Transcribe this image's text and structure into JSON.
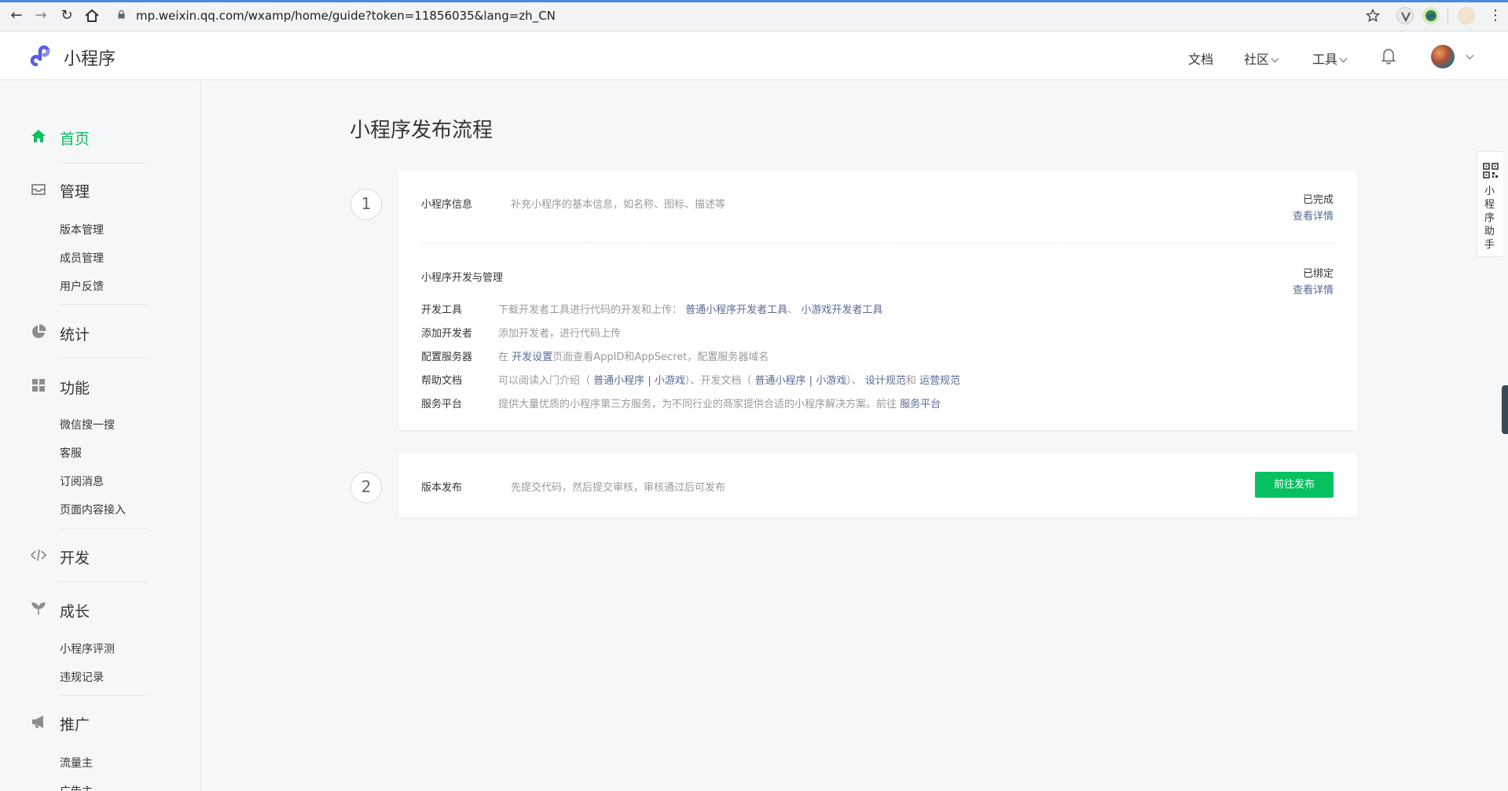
{
  "browser": {
    "url": "mp.weixin.qq.com/wxamp/home/guide?token=11856035&lang=zh_CN"
  },
  "header": {
    "brand": "小程序",
    "nav": {
      "docs": "文档",
      "community": "社区",
      "tools": "工具"
    }
  },
  "sidebar": {
    "home": "首页",
    "manage": "管理",
    "manage_items": [
      "版本管理",
      "成员管理",
      "用户反馈"
    ],
    "stats": "统计",
    "features": "功能",
    "feature_items": [
      "微信搜一搜",
      "客服",
      "订阅消息",
      "页面内容接入"
    ],
    "develop": "开发",
    "growth": "成长",
    "growth_items": [
      "小程序评测",
      "违规记录"
    ],
    "promote": "推广",
    "promote_items": [
      "流量主",
      "广告主"
    ]
  },
  "main": {
    "title": "小程序发布流程",
    "step1": {
      "number": "1",
      "info_label": "小程序信息",
      "info_desc": "补充小程序的基本信息，如名称、图标、描述等",
      "info_status": "已完成",
      "info_link": "查看详情",
      "dev_label": "小程序开发与管理",
      "dev_status": "已绑定",
      "dev_link": "查看详情",
      "rows": {
        "tools_label": "开发工具",
        "tools_text": "下载开发者工具进行代码的开发和上传：",
        "tools_link1": "普通小程序开发者工具",
        "tools_sep": "、",
        "tools_link2": "小游戏开发者工具",
        "adddev_label": "添加开发者",
        "adddev_text": "添加开发者，进行代码上传",
        "server_label": "配置服务器",
        "server_pre": "在",
        "server_link": "开发设置",
        "server_post": "页面查看AppID和AppSecret，配置服务器域名",
        "help_label": "帮助文档",
        "help_t1": "可以阅读入门介绍（",
        "help_l1": "普通小程序",
        "help_bar": "|",
        "help_l2": "小游戏",
        "help_t2": "）、开发文档（",
        "help_l3": "普通小程序",
        "help_l4": "小游戏",
        "help_t3": "）、",
        "help_l5": "设计规范",
        "help_and": "和",
        "help_l6": "运营规范",
        "platform_label": "服务平台",
        "platform_text": "提供大量优质的小程序第三方服务，为不同行业的商家提供合适的小程序解决方案。前往",
        "platform_link": "服务平台"
      }
    },
    "step2": {
      "number": "2",
      "label": "版本发布",
      "desc": "先提交代码，然后提交审核，审核通过后可发布",
      "button": "前往发布"
    }
  },
  "assistant": {
    "label": "小程序助手"
  },
  "colors": {
    "accent_green": "#07c160",
    "link_blue": "#576b95"
  }
}
